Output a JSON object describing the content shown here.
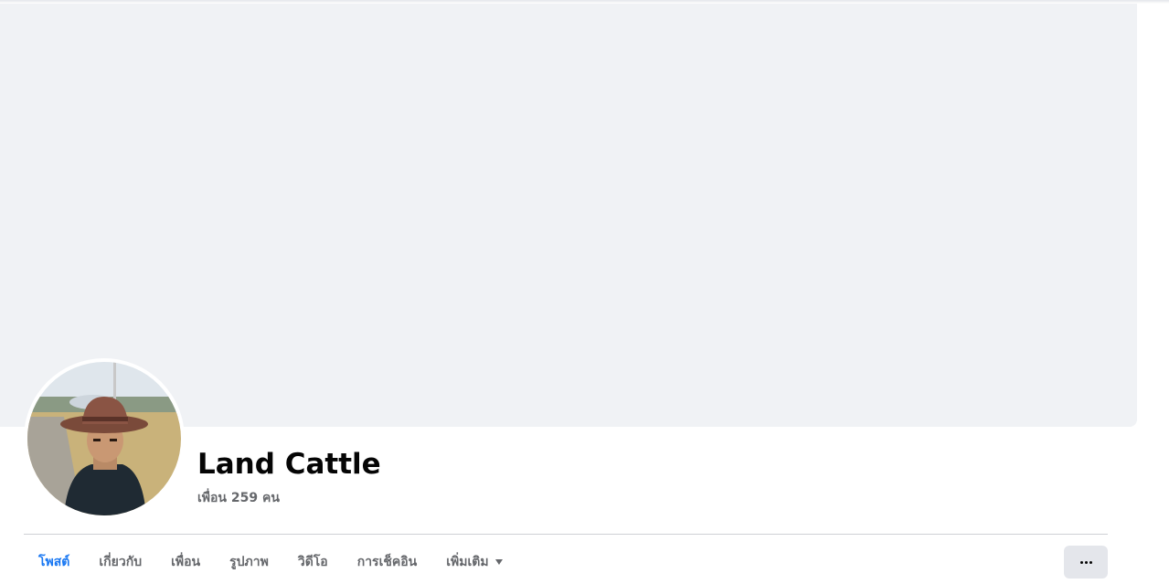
{
  "profile": {
    "name": "Land Cattle",
    "friend_count": "เพื่อน 259 คน",
    "avatar": "profile-photo"
  },
  "tabs": [
    {
      "label": "โพสต์",
      "active": true
    },
    {
      "label": "เกี่ยวกับ",
      "active": false
    },
    {
      "label": "เพื่อน",
      "active": false
    },
    {
      "label": "รูปภาพ",
      "active": false
    },
    {
      "label": "วิดีโอ",
      "active": false
    },
    {
      "label": "การเช็คอิน",
      "active": false
    },
    {
      "label": "เพิ่มเติม",
      "active": false,
      "icon": "caret-down-icon"
    }
  ],
  "actions": {
    "more_icon": "more-horizontal-icon"
  },
  "colors": {
    "active_tab": "#1877f2",
    "cover": "#f0f2f5",
    "muted_text": "#65676b"
  }
}
